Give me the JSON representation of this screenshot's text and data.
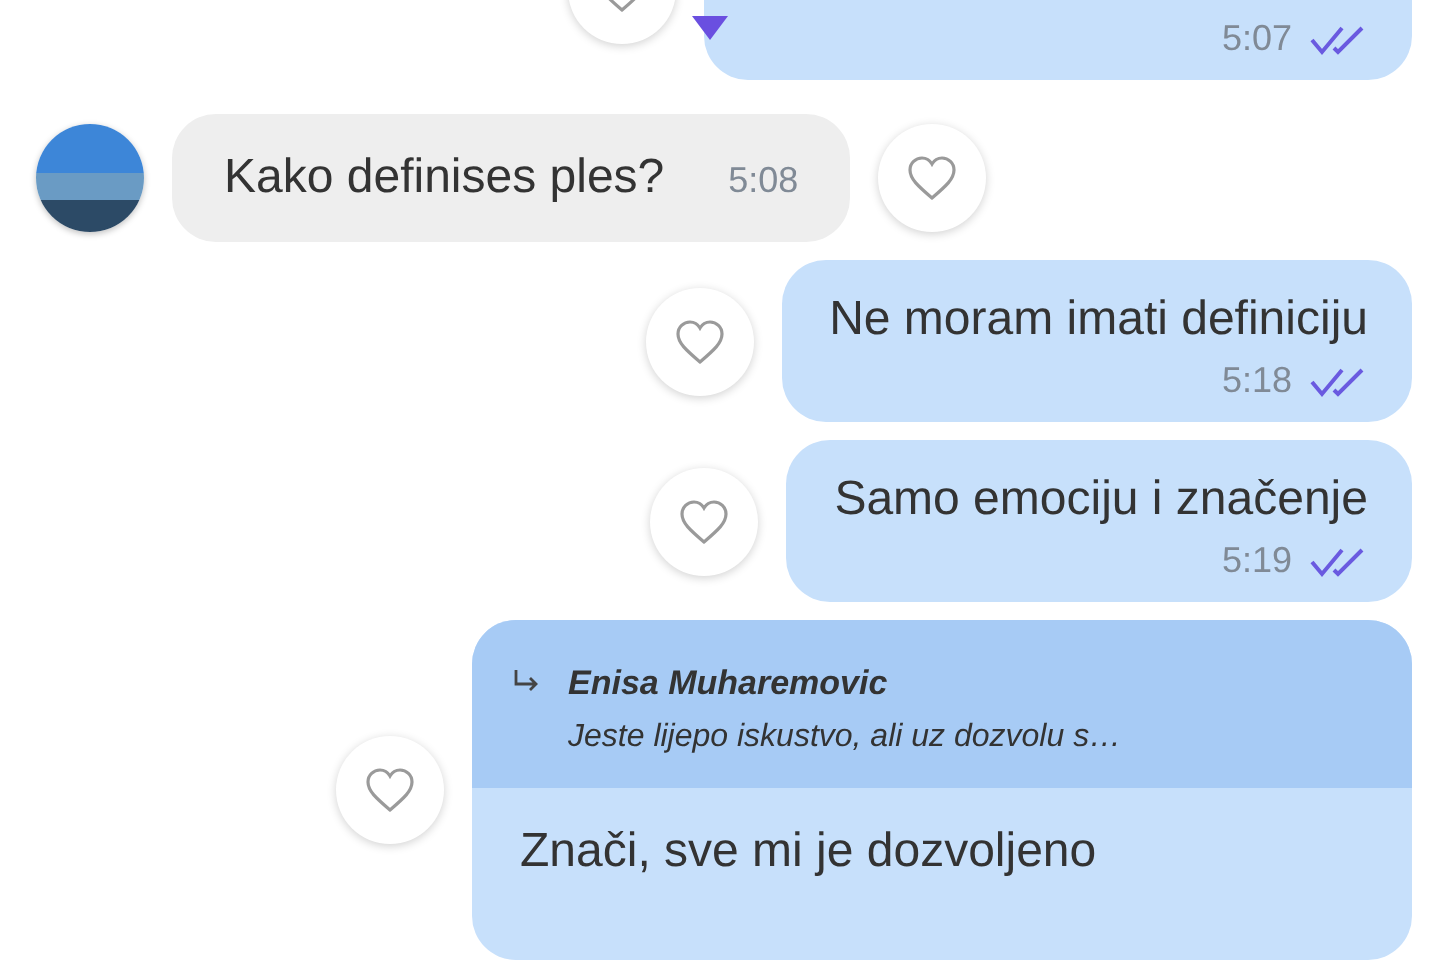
{
  "messages": [
    {
      "kind": "outgoing",
      "time": "5:07",
      "read": true
    },
    {
      "kind": "incoming",
      "text": "Kako definises ples?",
      "time": "5:08"
    },
    {
      "kind": "outgoing",
      "text": "Ne moram imati definiciju",
      "time": "5:18",
      "read": true
    },
    {
      "kind": "outgoing",
      "text": "Samo emociju i značenje",
      "time": "5:19",
      "read": true
    },
    {
      "kind": "reply",
      "reply_to": {
        "name": "Enisa Muharemovic",
        "text": "Jeste lijepo iskustvo, ali uz dozvolu s…"
      },
      "text": "Znači, sve mi je dozvoljeno"
    }
  ]
}
